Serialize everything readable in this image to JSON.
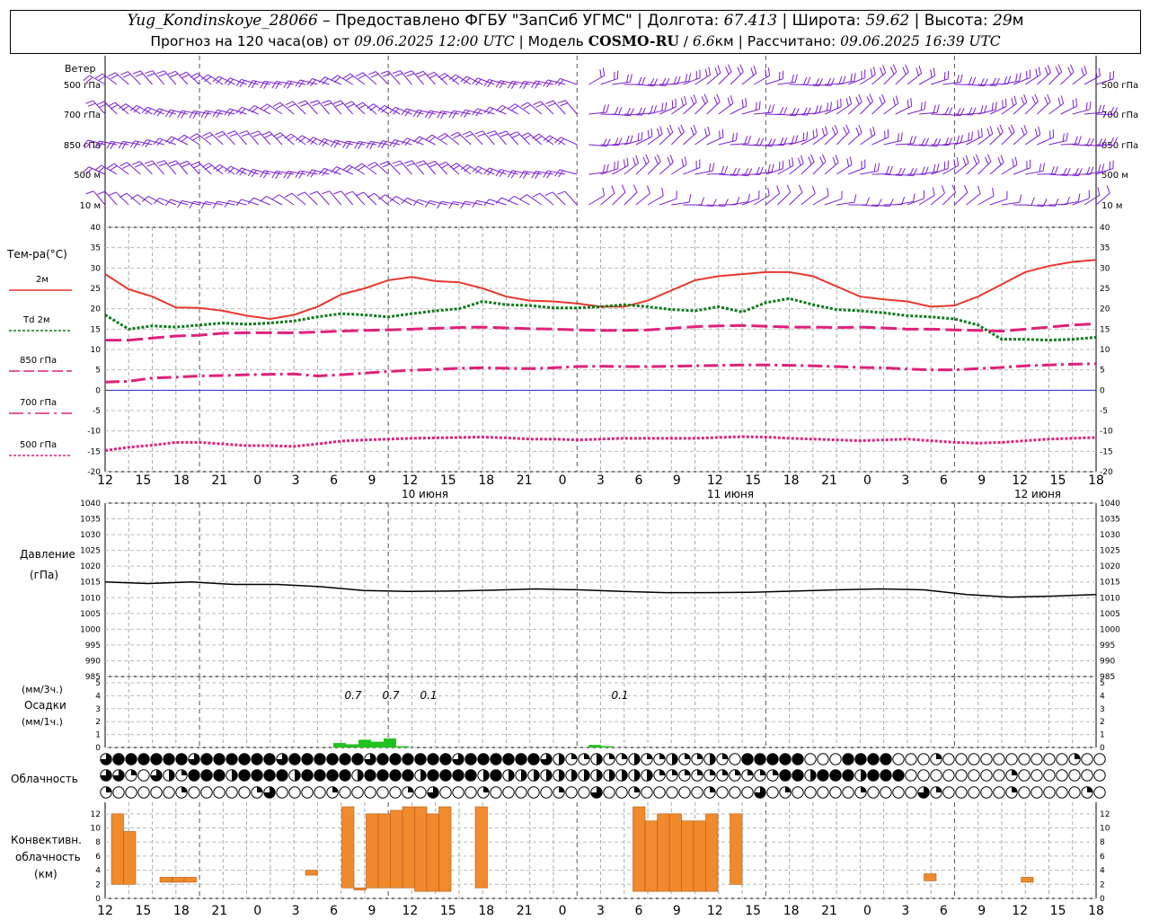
{
  "header": {
    "station": "Yug_Kondinskoye_28066",
    "provider_prefix": " – Предоставлено ФГБУ \"ЗапСиб УГМС\" | Долгота: ",
    "longitude": "67.413",
    "lat_label": " | Широта: ",
    "latitude": "59.62",
    "alt_label": " | Высота: ",
    "altitude": "29",
    "alt_unit": "м",
    "forecast_label": "Прогноз на 120 часа(ов) от ",
    "forecast_start": "09.06.2025 12:00 UTC",
    "model_label": "  | Модель ",
    "model": "COSMO-RU",
    "model_sep": " / ",
    "resolution": "6.6",
    "resolution_unit": "км",
    "computed_label": " | Рассчитано: ",
    "computed": "09.06.2025 16:39 UTC"
  },
  "wind_panel": {
    "title": "Ветер",
    "levels": [
      "500 гПа",
      "700 гПа",
      "850 гПа",
      "500 м",
      "10  м"
    ],
    "color": "#7b1fd0"
  },
  "temp_panel": {
    "title": "Тем-ра(°C)",
    "legend": [
      {
        "label": "2м",
        "color": "#e8372d",
        "style": "solid"
      },
      {
        "label": "Td  2м",
        "color": "#0f7a1a",
        "style": "dotted"
      },
      {
        "label": "850 гПа",
        "color": "#e0207a",
        "style": "dashed"
      },
      {
        "label": "700 гПа",
        "color": "#e0207a",
        "style": "dashdot"
      },
      {
        "label": "500 гПа",
        "color": "#e0207a",
        "style": "dotted"
      }
    ],
    "y_ticks": [
      "40",
      "35",
      "30",
      "25",
      "20",
      "15",
      "10",
      "5",
      "0",
      "-5",
      "-10",
      "-15",
      "-20"
    ]
  },
  "time_axis": {
    "hour_labels": [
      "12",
      "15",
      "18",
      "21",
      "0",
      "3",
      "6",
      "9",
      "12",
      "15",
      "18",
      "21",
      "0",
      "3",
      "6",
      "9",
      "12",
      "15",
      "18",
      "21",
      "0",
      "3",
      "6",
      "9",
      "12",
      "15",
      "18"
    ],
    "day_labels": [
      "10 июня",
      "11 июня",
      "12 июня"
    ]
  },
  "pressure_panel": {
    "title": "Давление",
    "unit": "(гПа)",
    "y_ticks": [
      "1040",
      "1035",
      "1030",
      "1025",
      "1020",
      "1015",
      "1010",
      "1005",
      "1000",
      "995",
      "990",
      "985"
    ]
  },
  "precip_panel": {
    "unit_3h": "(мм/3ч.)",
    "title": "Осадки",
    "unit_1h": "(мм/1ч.)",
    "y_ticks": [
      "5",
      "4",
      "3",
      "2",
      "1",
      "0"
    ],
    "labels": [
      "0.7",
      "0.7",
      "0.1",
      "0.1"
    ],
    "color": "#22c21e"
  },
  "cloud_panel": {
    "title": "Облачность"
  },
  "conv_panel": {
    "title_1": "Конвективн.",
    "title_2": "облачность",
    "unit": "(км)",
    "y_ticks": [
      "12",
      "10",
      "8",
      "6",
      "4",
      "2",
      "0"
    ],
    "color": "#f08a2c"
  },
  "chart_data": [
    {
      "type": "line",
      "title": "Тем-ра(°C)",
      "x_hours": [
        0,
        3,
        6,
        9,
        12,
        15,
        18,
        21,
        24,
        27,
        30,
        33,
        36,
        39,
        42,
        45,
        48,
        51,
        54,
        57,
        60,
        63,
        66,
        69,
        72,
        75,
        78,
        81,
        84,
        87,
        90,
        93,
        96,
        99,
        102,
        105,
        108,
        111,
        114,
        117,
        120,
        123,
        126
      ],
      "series": [
        {
          "name": "2м",
          "values": [
            28.5,
            24.8,
            23,
            20.3,
            20.2,
            19.5,
            18.3,
            17.5,
            18.5,
            20.5,
            23.5,
            25,
            27,
            27.8,
            26.8,
            26.5,
            25,
            23,
            22,
            21.8,
            21.3,
            20.5,
            20.5,
            22,
            24.5,
            27,
            28,
            28.5,
            29,
            29,
            28,
            25.5,
            23,
            22.3,
            21.8,
            20.5,
            20.8,
            23,
            26,
            29,
            30.5,
            31.5,
            32
          ]
        },
        {
          "name": "Td 2м",
          "values": [
            18.5,
            15,
            15.8,
            15.5,
            16,
            16.5,
            16.2,
            16.5,
            17,
            18,
            18.8,
            18.5,
            18,
            18.8,
            19.5,
            20,
            21.8,
            21,
            20.8,
            20.2,
            20.2,
            20.5,
            21,
            20.5,
            19.8,
            19.5,
            20.5,
            19.2,
            21.5,
            22.5,
            21,
            19.8,
            19.5,
            19,
            18.3,
            18,
            17.5,
            16,
            12.5,
            12.5,
            12.3,
            12.5,
            13
          ]
        },
        {
          "name": "850 гПа",
          "values": [
            12.3,
            12.3,
            12.8,
            13.3,
            13.5,
            14,
            14.1,
            14.1,
            14.1,
            14.3,
            14.5,
            14.7,
            14.8,
            15,
            15.2,
            15.4,
            15.5,
            15.3,
            15.1,
            15,
            14.8,
            14.7,
            14.7,
            14.8,
            15.2,
            15.6,
            15.8,
            15.9,
            15.7,
            15.5,
            15.5,
            15.4,
            15.5,
            15.3,
            15,
            15,
            14.8,
            14.7,
            14.5,
            15,
            15.5,
            16,
            16.3
          ]
        },
        {
          "name": "700 гПа",
          "values": [
            2,
            2.2,
            3,
            3.2,
            3.5,
            3.6,
            3.8,
            3.9,
            4,
            3.5,
            3.8,
            4.2,
            4.6,
            4.9,
            5.1,
            5.4,
            5.5,
            5.4,
            5.3,
            5.5,
            5.8,
            5.9,
            5.8,
            5.8,
            5.9,
            6,
            6.1,
            6.2,
            6.2,
            6.1,
            6,
            5.8,
            5.6,
            5.5,
            5.2,
            5,
            5,
            5.3,
            5.6,
            6,
            6.2,
            6.4,
            6.5
          ]
        },
        {
          "name": "500 гПа",
          "values": [
            -14.8,
            -14,
            -13.5,
            -12.8,
            -12.8,
            -13.2,
            -13.6,
            -13.6,
            -13.8,
            -13.2,
            -12.5,
            -12.2,
            -12,
            -11.8,
            -11.7,
            -11.6,
            -11.5,
            -11.7,
            -12,
            -12,
            -12.2,
            -12,
            -11.8,
            -11.8,
            -11.8,
            -11.8,
            -11.6,
            -11.4,
            -11.5,
            -11.8,
            -12,
            -12.2,
            -12.4,
            -12.2,
            -12,
            -12.4,
            -12.8,
            -13,
            -12.8,
            -12.4,
            -12,
            -11.8,
            -11.6
          ]
        }
      ],
      "ylim": [
        -20,
        40
      ]
    },
    {
      "type": "line",
      "title": "Давление",
      "x_hours": [
        0,
        6,
        12,
        18,
        24,
        30,
        36,
        42,
        48,
        54,
        60,
        66,
        72,
        78,
        84,
        90,
        96,
        102,
        108,
        114,
        120,
        126
      ],
      "series": [
        {
          "name": "Давление",
          "values": [
            1015,
            1014.5,
            1015,
            1014.2,
            1014.2,
            1013.5,
            1012.3,
            1012,
            1012.1,
            1012.4,
            1012.8,
            1012.5,
            1012,
            1011.6,
            1011.6,
            1011.7,
            1012.1,
            1012.5,
            1012.8,
            1012.5,
            1011,
            1010.2,
            1010.5,
            1011
          ]
        }
      ],
      "ylim": [
        985,
        1040
      ]
    },
    {
      "type": "bar",
      "title": "Осадки",
      "x_hours": [
        30,
        33,
        36,
        39,
        42,
        45,
        66,
        69
      ],
      "values": [
        0.35,
        0.25,
        0.6,
        0.45,
        0.7,
        0.1,
        0.2,
        0.1
      ],
      "ylim": [
        0,
        5
      ]
    },
    {
      "type": "bar",
      "title": "Конвективн. облачность",
      "bars": [
        {
          "h0": 0,
          "h1": 1.5,
          "base": 2,
          "top": 12
        },
        {
          "h0": 1.5,
          "h1": 3,
          "base": 2,
          "top": 9.5
        },
        {
          "h0": 6,
          "h1": 7.5,
          "base": 2.3,
          "top": 3
        },
        {
          "h0": 7.5,
          "h1": 9,
          "base": 2.3,
          "top": 3
        },
        {
          "h0": 9,
          "h1": 10.5,
          "base": 2.3,
          "top": 3
        },
        {
          "h0": 24,
          "h1": 25.5,
          "base": 3.3,
          "top": 4
        },
        {
          "h0": 28.5,
          "h1": 30,
          "base": 1.5,
          "top": 13
        },
        {
          "h0": 30,
          "h1": 31.5,
          "base": 1.2,
          "top": 1.5
        },
        {
          "h0": 31.5,
          "h1": 33,
          "base": 1.5,
          "top": 12
        },
        {
          "h0": 33,
          "h1": 34.5,
          "base": 1.5,
          "top": 12
        },
        {
          "h0": 34.5,
          "h1": 36,
          "base": 1.5,
          "top": 12.5
        },
        {
          "h0": 36,
          "h1": 37.5,
          "base": 1.5,
          "top": 13
        },
        {
          "h0": 37.5,
          "h1": 39,
          "base": 1,
          "top": 13
        },
        {
          "h0": 39,
          "h1": 40.5,
          "base": 1,
          "top": 12
        },
        {
          "h0": 40.5,
          "h1": 42,
          "base": 1,
          "top": 13
        },
        {
          "h0": 45,
          "h1": 46.5,
          "base": 1.5,
          "top": 13
        },
        {
          "h0": 64.5,
          "h1": 66,
          "base": 1,
          "top": 13
        },
        {
          "h0": 66,
          "h1": 67.5,
          "base": 1,
          "top": 11
        },
        {
          "h0": 67.5,
          "h1": 69,
          "base": 1,
          "top": 12
        },
        {
          "h0": 69,
          "h1": 70.5,
          "base": 1,
          "top": 12
        },
        {
          "h0": 70.5,
          "h1": 72,
          "base": 1,
          "top": 11
        },
        {
          "h0": 72,
          "h1": 73.5,
          "base": 1,
          "top": 11
        },
        {
          "h0": 73.5,
          "h1": 75,
          "base": 1,
          "top": 12
        },
        {
          "h0": 76.5,
          "h1": 78,
          "base": 2,
          "top": 12
        },
        {
          "h0": 100.5,
          "h1": 102,
          "base": 2.5,
          "top": 3.5
        },
        {
          "h0": 112.5,
          "h1": 114,
          "base": 2.3,
          "top": 3
        }
      ],
      "ylim": [
        0,
        13
      ]
    }
  ]
}
